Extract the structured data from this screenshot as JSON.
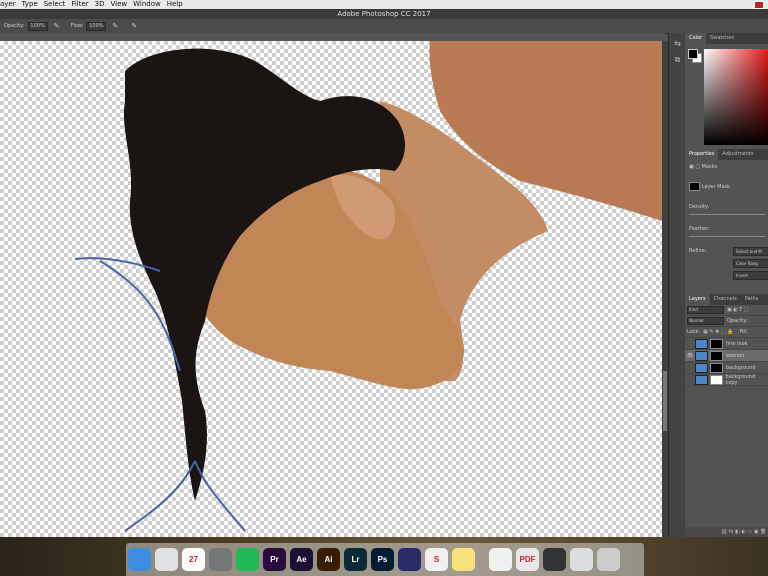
{
  "menubar": {
    "items": [
      "ayer",
      "Type",
      "Select",
      "Filter",
      "3D",
      "View",
      "Window",
      "Help"
    ]
  },
  "title": "Adobe Photoshop CC 2017",
  "options": {
    "opacity_label": "Opacity:",
    "opacity_value": "100%",
    "flow_label": "Flow:",
    "flow_value": "100%"
  },
  "color_panel": {
    "tabs": [
      "Color",
      "Swatches"
    ]
  },
  "properties": {
    "tabs": [
      "Properties",
      "Adjustments"
    ],
    "masks_label": "Masks",
    "layer_mask_label": "Layer Mask",
    "density_label": "Density:",
    "feather_label": "Feather:",
    "refine_label": "Refine:",
    "buttons": [
      "Select and M",
      "Color Rang",
      "Invert"
    ]
  },
  "layers": {
    "tabs": [
      "Layers",
      "Channels",
      "Paths"
    ],
    "kind_label": "Kind",
    "blend_mode": "Normal",
    "opacity_label": "Opacity:",
    "lock_label": "Lock:",
    "fill_label": "Fill:",
    "items": [
      {
        "name": "hire look",
        "selected": false,
        "eye": false,
        "mask": "black"
      },
      {
        "name": "woman",
        "selected": true,
        "eye": true,
        "mask": "black"
      },
      {
        "name": "background",
        "selected": false,
        "eye": false,
        "mask": "black"
      },
      {
        "name": "background copy",
        "selected": false,
        "eye": false,
        "mask": "white"
      }
    ]
  },
  "dock": {
    "apps": [
      {
        "name": "finder",
        "label": "",
        "color": "#3d8de0"
      },
      {
        "name": "chrome",
        "label": "",
        "color": "#e0e0e0"
      },
      {
        "name": "calendar",
        "label": "27",
        "color": "#ffffff"
      },
      {
        "name": "system-preferences",
        "label": "",
        "color": "#777777"
      },
      {
        "name": "spotify",
        "label": "",
        "color": "#1db954"
      },
      {
        "name": "premiere",
        "label": "Pr",
        "color": "#2a0b3e"
      },
      {
        "name": "after-effects",
        "label": "Ae",
        "color": "#1c1035"
      },
      {
        "name": "illustrator",
        "label": "Ai",
        "color": "#3a1d00"
      },
      {
        "name": "lightroom",
        "label": "Lr",
        "color": "#0b2a3a"
      },
      {
        "name": "photoshop",
        "label": "Ps",
        "color": "#001d34"
      },
      {
        "name": "image-app",
        "label": "",
        "color": "#2b2b6a"
      },
      {
        "name": "sketchbook",
        "label": "S",
        "color": "#f0f0f0"
      },
      {
        "name": "notes",
        "label": "",
        "color": "#f6e27a"
      },
      {
        "name": "music",
        "label": "",
        "color": "#f0f0f0"
      },
      {
        "name": "acrobat",
        "label": "PDF",
        "color": "#e8e8e8"
      },
      {
        "name": "video-tool",
        "label": "",
        "color": "#333333"
      },
      {
        "name": "screen-app",
        "label": "",
        "color": "#dddddd"
      },
      {
        "name": "trash",
        "label": "",
        "color": "#cccccc"
      }
    ]
  }
}
